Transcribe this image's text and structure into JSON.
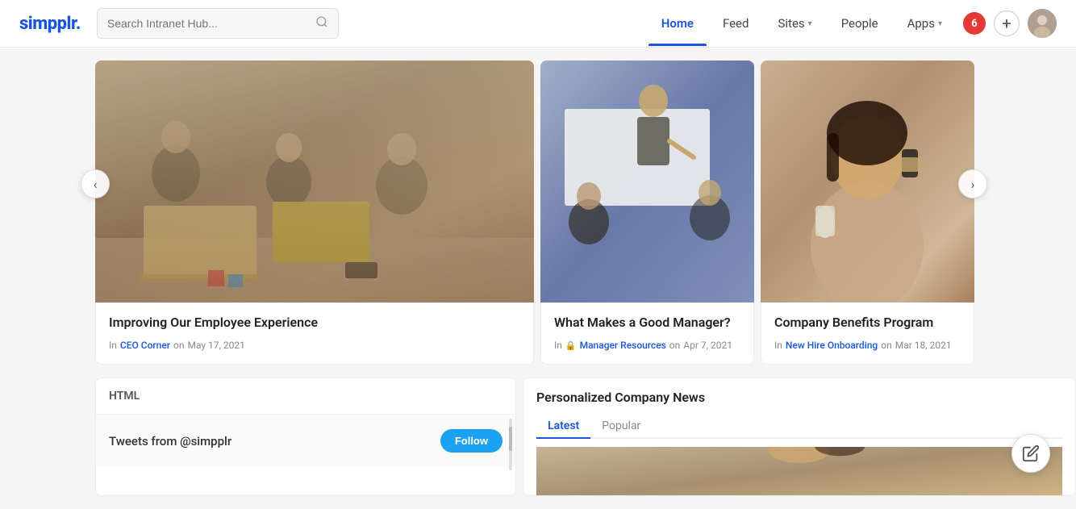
{
  "navbar": {
    "logo": "simpplr.",
    "search_placeholder": "Search Intranet Hub...",
    "links": [
      {
        "id": "home",
        "label": "Home",
        "active": true,
        "has_chevron": false
      },
      {
        "id": "feed",
        "label": "Feed",
        "active": false,
        "has_chevron": false
      },
      {
        "id": "sites",
        "label": "Sites",
        "active": false,
        "has_chevron": true
      },
      {
        "id": "people",
        "label": "People",
        "active": false,
        "has_chevron": false
      },
      {
        "id": "apps",
        "label": "Apps",
        "active": false,
        "has_chevron": true
      }
    ],
    "notification_count": "6",
    "add_icon": "+"
  },
  "carousel": {
    "prev_label": "‹",
    "next_label": "›",
    "cards": [
      {
        "id": "card1",
        "title": "Improving Our Employee Experience",
        "in_label": "In",
        "category": "CEO Corner",
        "date_prefix": "on",
        "date": "May 17, 2021",
        "has_lock": false,
        "img_type": "office"
      },
      {
        "id": "card2",
        "title": "What Makes a Good Manager?",
        "in_label": "In",
        "category": "Manager Resources",
        "date_prefix": "on",
        "date": "Apr 7, 2021",
        "has_lock": true,
        "img_type": "meeting"
      },
      {
        "id": "card3",
        "title": "Company Benefits Program",
        "in_label": "In",
        "category": "New Hire Onboarding",
        "date_prefix": "on",
        "date": "Mar 18, 2021",
        "has_lock": false,
        "img_type": "woman"
      }
    ]
  },
  "html_widget": {
    "header": "HTML",
    "tweet_text": "Tweets from @simpplr",
    "follow_label": "Follow"
  },
  "news_widget": {
    "title": "Personalized Company News",
    "tabs": [
      {
        "id": "latest",
        "label": "Latest",
        "active": true
      },
      {
        "id": "popular",
        "label": "Popular",
        "active": false
      }
    ]
  },
  "fab": {
    "icon": "✏"
  }
}
